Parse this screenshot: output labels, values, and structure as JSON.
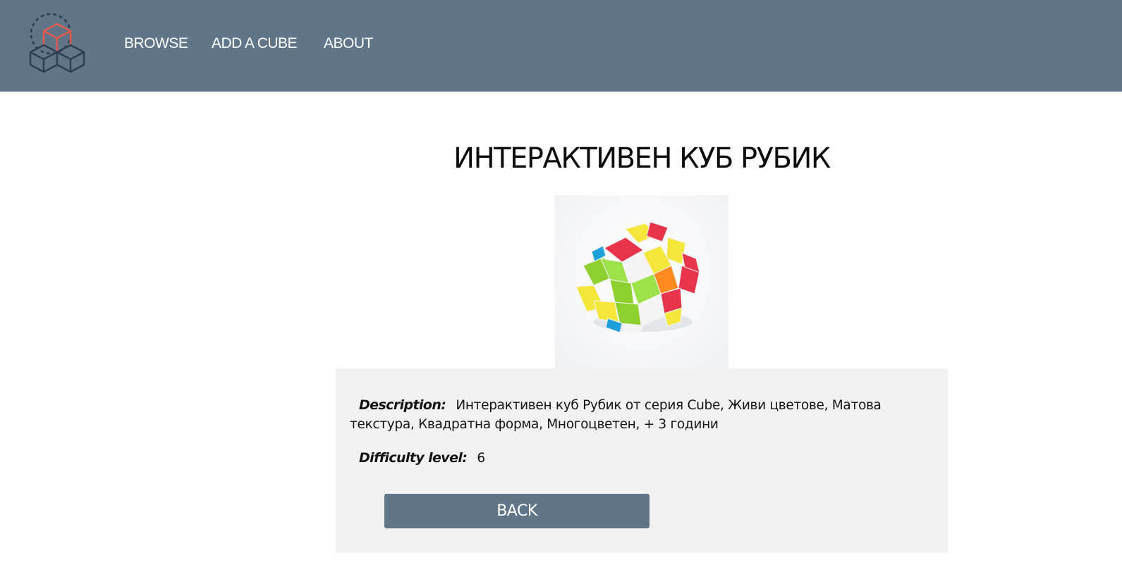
{
  "header": {
    "background_color": "#617589",
    "logo_icon": "cubes-logo-icon",
    "nav": [
      {
        "label": "BROWSE"
      },
      {
        "label": "ADD A CUBE"
      },
      {
        "label": "ABOUT"
      }
    ]
  },
  "main": {
    "title": "ИНТЕРАКТИВЕН КУБ РУБИК",
    "image_icon": "rubiks-cube-photo",
    "details": {
      "description_label": "Description:",
      "description_value": "Интерактивен куб Рубик от серия Cube, Живи цветове, Матова текстура, Квадратна форма, Многоцветен, + 3 години",
      "difficulty_label": "Difficulty level:",
      "difficulty_value": "6"
    },
    "back_label": "BACK"
  },
  "colors": {
    "accent": "#617589",
    "panel": "#f2f2f2",
    "logo_highlight": "#e05a4f"
  }
}
